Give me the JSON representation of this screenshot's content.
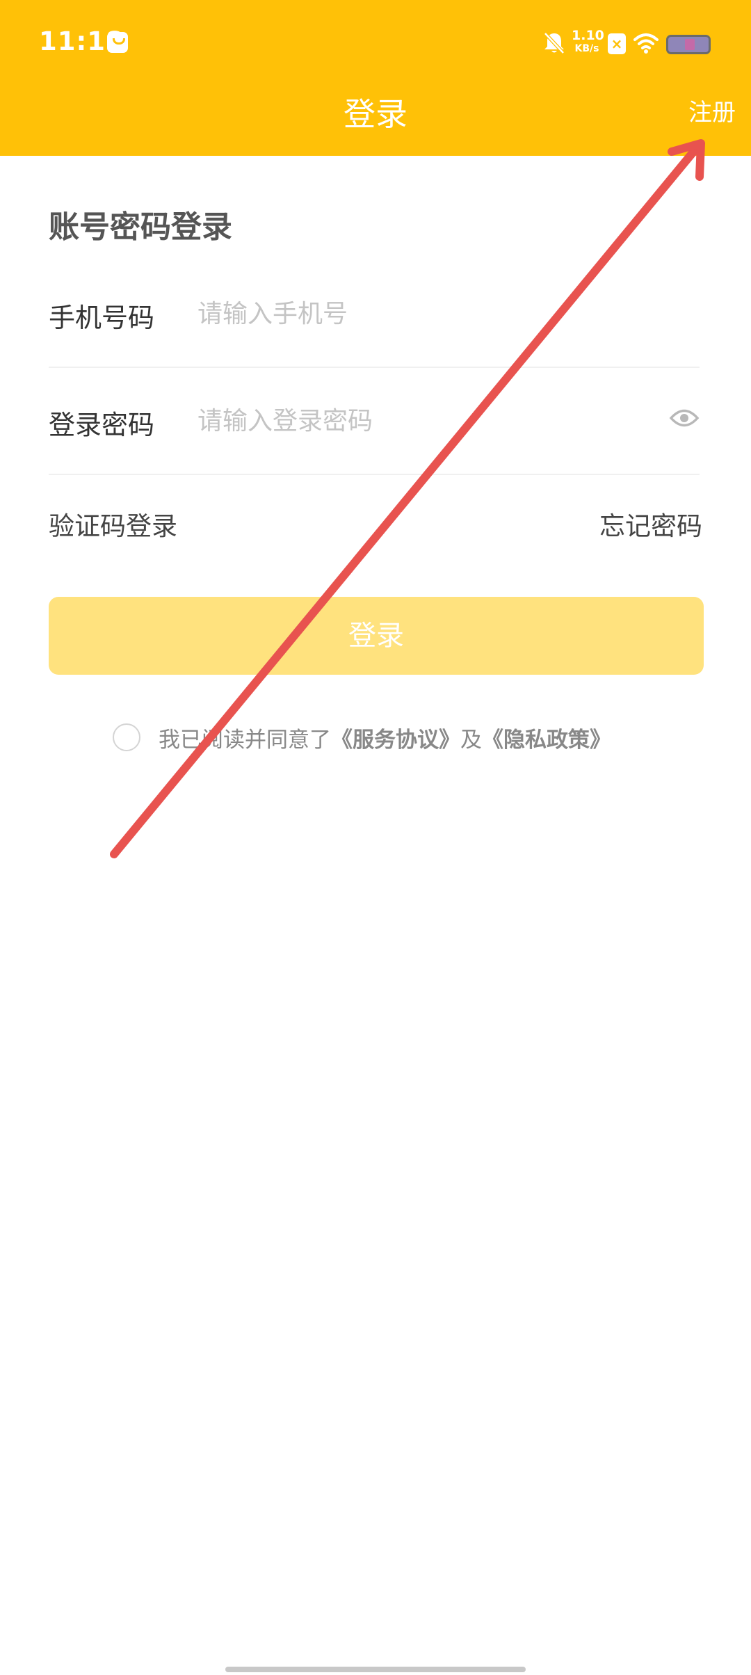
{
  "status_bar": {
    "time": "11:18",
    "speed_value": "1.10",
    "speed_unit": "KB/s"
  },
  "nav": {
    "title": "登录",
    "register_label": "注册"
  },
  "form": {
    "section_title": "账号密码登录",
    "phone_label": "手机号码",
    "phone_placeholder": "请输入手机号",
    "phone_value": "",
    "password_label": "登录密码",
    "password_placeholder": "请输入登录密码",
    "password_value": "",
    "sms_login_label": "验证码登录",
    "forgot_password_label": "忘记密码",
    "login_button_label": "登录"
  },
  "agreement": {
    "checked": false,
    "prefix": "我已阅读并同意了",
    "service_link": "《服务协议》",
    "conjunction": "及",
    "privacy_link": "《隐私政策》"
  },
  "colors": {
    "header": "#FFC107",
    "login_button_disabled": "#FFE27E",
    "annotation_arrow": "#E8534F"
  },
  "icons": {
    "password_visibility": "eye-icon",
    "notification_status": "bell-off-icon",
    "wifi_status": "wifi-icon"
  }
}
